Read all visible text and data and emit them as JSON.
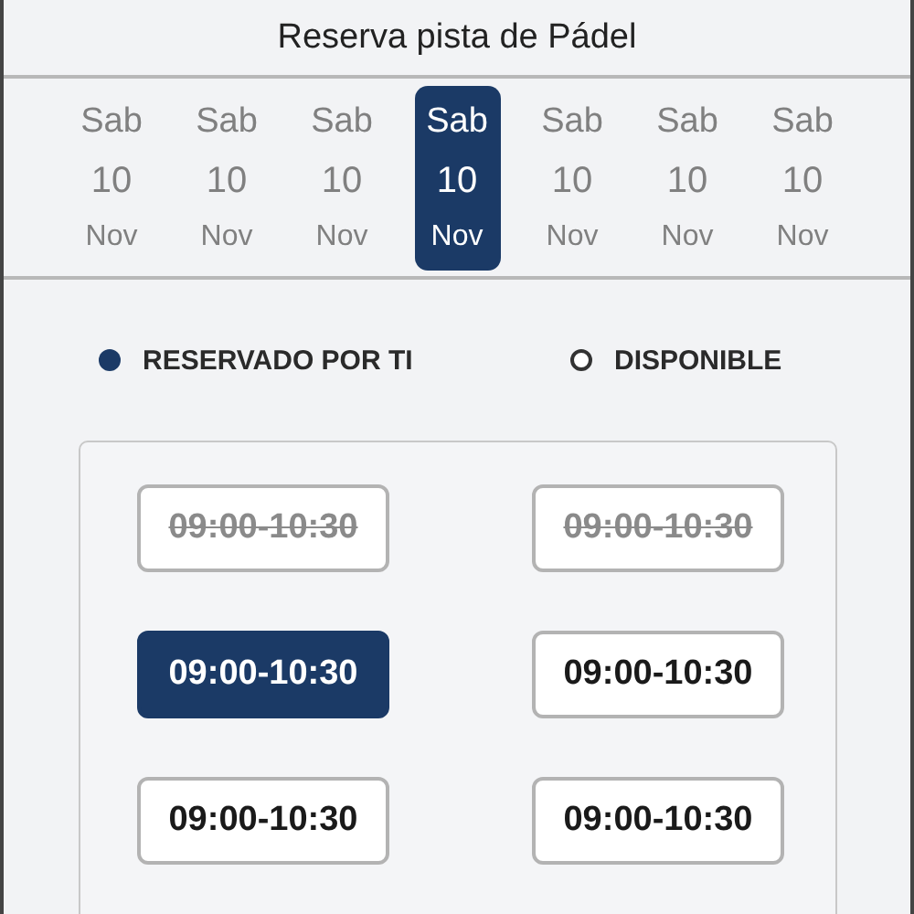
{
  "header": {
    "title": "Reserva pista de Pádel"
  },
  "days": [
    {
      "weekday": "Sab",
      "day": "10",
      "month": "Nov",
      "selected": false
    },
    {
      "weekday": "Sab",
      "day": "10",
      "month": "Nov",
      "selected": false
    },
    {
      "weekday": "Sab",
      "day": "10",
      "month": "Nov",
      "selected": false
    },
    {
      "weekday": "Sab",
      "day": "10",
      "month": "Nov",
      "selected": true
    },
    {
      "weekday": "Sab",
      "day": "10",
      "month": "Nov",
      "selected": false
    },
    {
      "weekday": "Sab",
      "day": "10",
      "month": "Nov",
      "selected": false
    },
    {
      "weekday": "Sab",
      "day": "10",
      "month": "Nov",
      "selected": false
    }
  ],
  "legend": [
    {
      "kind": "reserved",
      "label": "RESERVADO POR TI"
    },
    {
      "kind": "available",
      "label": "DISPONIBLE"
    }
  ],
  "slots": [
    {
      "time": "09:00-10:30",
      "disabled": true,
      "selected": false
    },
    {
      "time": "09:00-10:30",
      "disabled": true,
      "selected": false
    },
    {
      "time": "09:00-10:30",
      "disabled": false,
      "selected": true
    },
    {
      "time": "09:00-10:30",
      "disabled": false,
      "selected": false
    },
    {
      "time": "09:00-10:30",
      "disabled": false,
      "selected": false
    },
    {
      "time": "09:00-10:30",
      "disabled": false,
      "selected": false
    }
  ]
}
